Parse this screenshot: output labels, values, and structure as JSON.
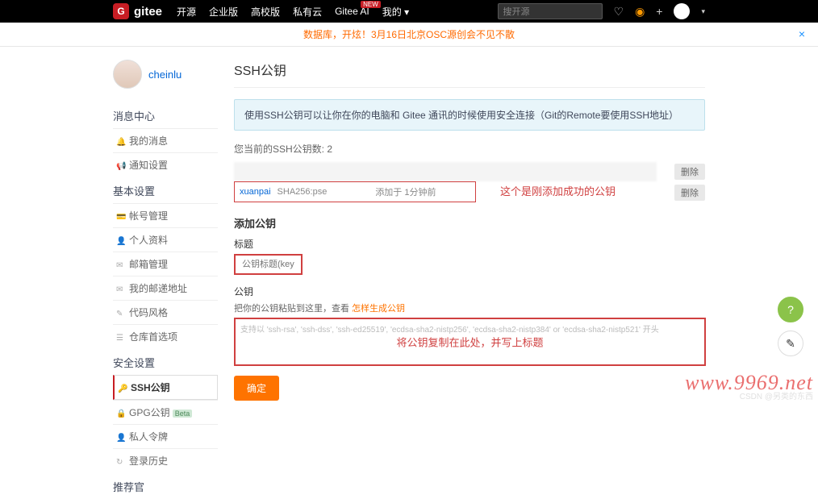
{
  "topbar": {
    "logo_letter": "G",
    "logo_text": "gitee",
    "nav": [
      "开源",
      "企业版",
      "高校版",
      "私有云",
      "Gitee AI",
      "我的"
    ],
    "nav_badge": "NEW",
    "search_placeholder": "搜开源"
  },
  "banner": {
    "text": "数据库，开炫！3月16日北京OSC源创会不见不散"
  },
  "user": {
    "name": "cheinlu"
  },
  "sidebar": {
    "group1_title": "消息中心",
    "group1": [
      "我的消息",
      "通知设置"
    ],
    "group2_title": "基本设置",
    "group2": [
      "帐号管理",
      "个人资料",
      "邮箱管理",
      "我的邮递地址",
      "代码风格",
      "仓库首选项"
    ],
    "group3_title": "安全设置",
    "group3": [
      "SSH公钥",
      "GPG公钥",
      "私人令牌",
      "登录历史"
    ],
    "group4_title": "推荐官",
    "beta_label": "Beta"
  },
  "page": {
    "title": "SSH公钥",
    "info": "使用SSH公钥可以让你在你的电脑和 Gitee 通讯的时候使用安全连接（Git的Remote要使用SSH地址）",
    "count": "您当前的SSH公钥数: 2",
    "key_name": "xuanpai",
    "key_hash": "SHA256:pse",
    "key_time": "添加于 1分钟前",
    "delete_label": "删除",
    "annotation_success": "这个是刚添加成功的公钥",
    "form_title": "添加公钥",
    "title_label": "标题",
    "title_placeholder": "公钥标题(key)",
    "pubkey_label": "公钥",
    "pubkey_hint_prefix": "把你的公钥粘贴到这里，查看 ",
    "pubkey_hint_link": "怎样生成公钥",
    "pubkey_placeholder": "支持以 'ssh-rsa', 'ssh-dss', 'ssh-ed25519', 'ecdsa-sha2-nistp256', 'ecdsa-sha2-nistp384' or 'ecdsa-sha2-nistp521' 开头",
    "annotation_paste": "将公钥复制在此处，并写上标题",
    "submit": "确定"
  },
  "watermark": {
    "url": "www.9969.net",
    "csdn": "CSDN @另类的东西"
  }
}
